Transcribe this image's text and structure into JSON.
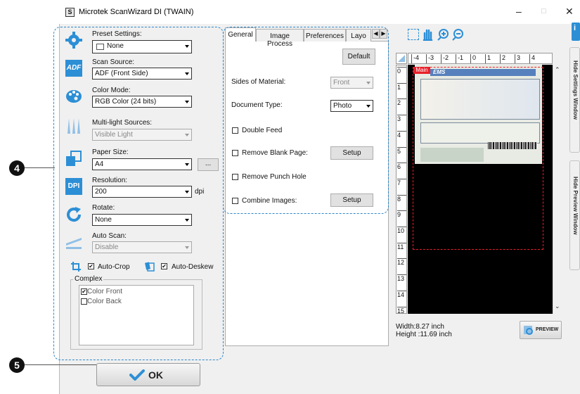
{
  "window": {
    "title": "Microtek ScanWizard DI (TWAIN)",
    "app_icon_letter": "S",
    "minimize": "–",
    "maximize": "□",
    "close": "✕"
  },
  "callouts": [
    "4",
    "5"
  ],
  "left": {
    "preset": {
      "label": "Preset Settings:",
      "value": "None"
    },
    "scan_source": {
      "label": "Scan Source:",
      "value": "ADF (Front Side)"
    },
    "color_mode": {
      "label": "Color Mode:",
      "value": "RGB Color (24 bits)"
    },
    "multilight": {
      "label": "Multi-light Sources:",
      "value": "Visible Light"
    },
    "paper_size": {
      "label": "Paper Size:",
      "value": "A4",
      "more": "..."
    },
    "resolution": {
      "label": "Resolution:",
      "value": "200",
      "unit": "dpi"
    },
    "rotate": {
      "label": "Rotate:",
      "value": "None"
    },
    "auto_scan": {
      "label": "Auto Scan:",
      "value": "Disable"
    },
    "auto_crop": "Auto-Crop",
    "auto_deskew": "Auto-Deskew",
    "complex": {
      "label": "Complex",
      "items": [
        "Color Front",
        "Color Back"
      ]
    },
    "icon_labels": {
      "dpi": "DPI",
      "adf": "ADF"
    }
  },
  "ok_button": "OK",
  "tabs": [
    "General",
    "Image Process",
    "Preferences",
    "Layo"
  ],
  "general": {
    "default_button": "Default",
    "sides_label": "Sides of Material:",
    "sides_value": "Front",
    "doctype_label": "Document Type:",
    "doctype_value": "Photo",
    "double_feed": "Double Feed",
    "remove_blank": "Remove Blank Page:",
    "remove_punch": "Remove Punch Hole",
    "combine": "Combine Images:",
    "setup": "Setup"
  },
  "preview": {
    "ruler_top": [
      "-4",
      "-3",
      "-2",
      "-1",
      "0",
      "1",
      "2",
      "3",
      "4"
    ],
    "ruler_left": [
      "0",
      "1",
      "2",
      "3",
      "4",
      "5",
      "6",
      "7",
      "8",
      "9",
      "10",
      "11",
      "12",
      "13",
      "14",
      "15"
    ],
    "main_tag": "Main",
    "doc_header": "EMS",
    "width": "Width:8.27 inch",
    "height": "Height :11.69 inch",
    "preview_button": "PREVIEW",
    "hide_settings": "Hide  Settings Window",
    "hide_preview": "Hide  Preview Window"
  }
}
